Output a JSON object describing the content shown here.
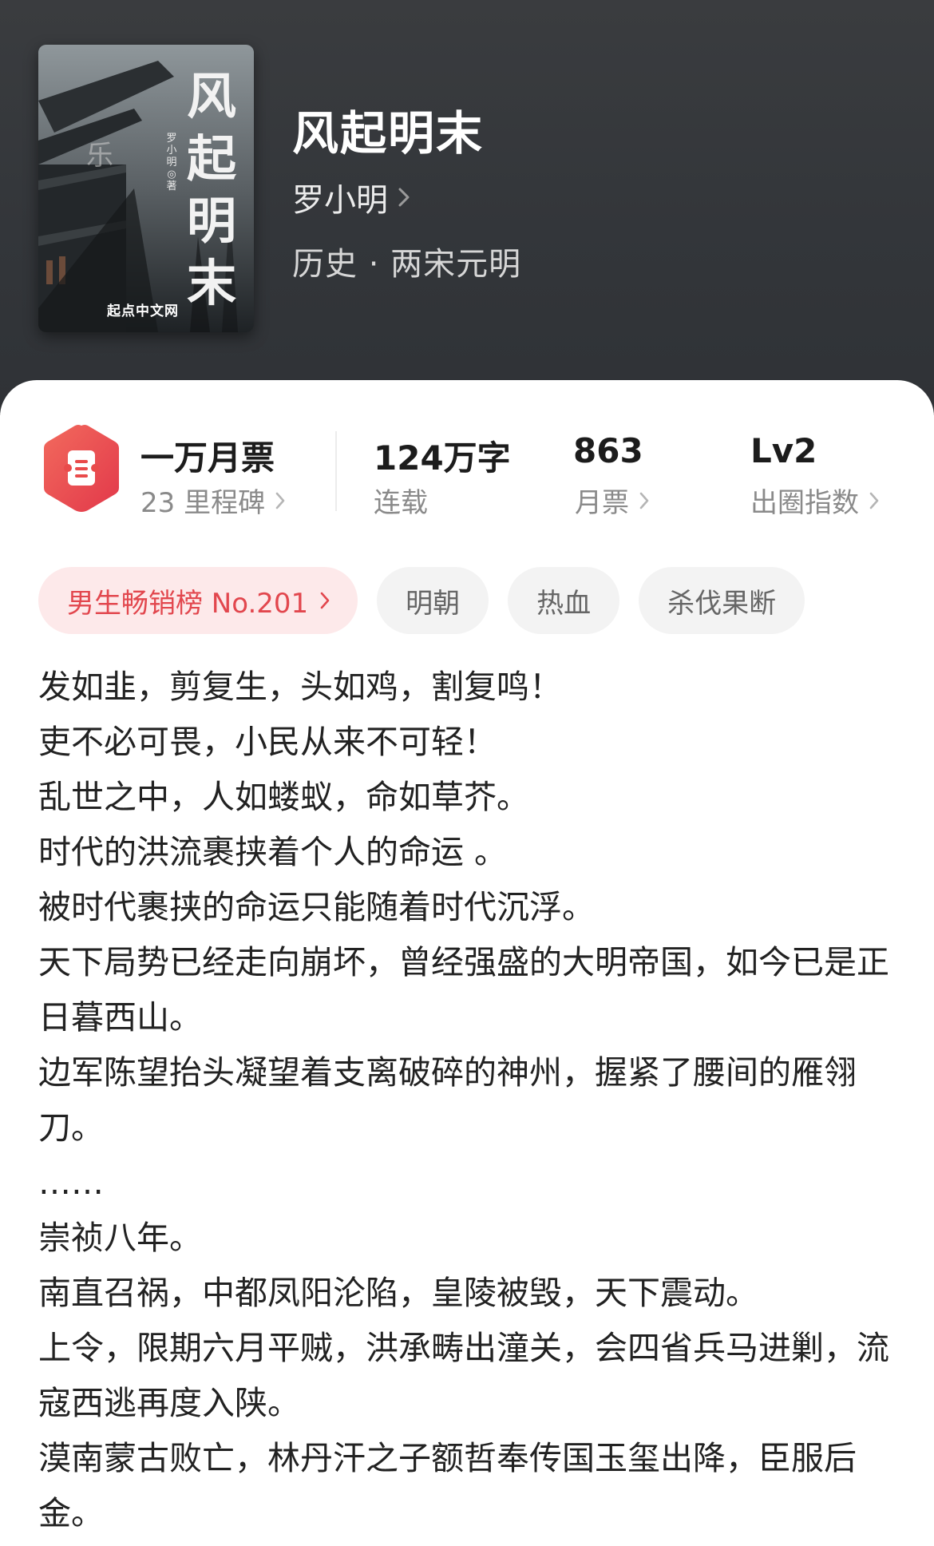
{
  "book": {
    "title": "风起明末",
    "author": "罗小明",
    "genre": "历史 · 两宋元明",
    "cover": {
      "title_chars": [
        "风",
        "起",
        "明",
        "末"
      ],
      "author_line": "罗小明 ◎ 著",
      "publisher": "起点中文网"
    }
  },
  "stats": {
    "badge": {
      "label": "一万月票",
      "sub": "23 里程碑",
      "icon": "hexagon-ticket-icon",
      "color": "#e94b4b"
    },
    "words": {
      "value": "124万字",
      "label": "连载"
    },
    "monthly_tickets": {
      "value": "863",
      "label": "月票"
    },
    "breakout": {
      "value": "Lv2",
      "label": "出圈指数"
    }
  },
  "tags": {
    "rank": "男生畅销榜 No.201",
    "items": [
      "明朝",
      "热血",
      "杀伐果断"
    ]
  },
  "intro": [
    "发如韭，剪复生，头如鸡，割复鸣！",
    "吏不必可畏，小民从来不可轻！",
    "乱世之中，人如蝼蚁，命如草芥。",
    "时代的洪流裹挟着个人的命运 。",
    "被时代裹挟的命运只能随着时代沉浮。",
    "天下局势已经走向崩坏，曾经强盛的大明帝国，如今已是正日暮西山。",
    "边军陈望抬头凝望着支离破碎的神州，握紧了腰间的雁翎刀。",
    "……",
    "崇祯八年。",
    "南直召祸，中都凤阳沦陷，皇陵被毁，天下震动。",
    "上令，限期六月平贼，洪承畴出潼关，会四省兵马进剿，流寇西逃再度入陕。",
    "漠南蒙古败亡，林丹汗之子额哲奉传国玉玺出降，臣服后金。"
  ]
}
